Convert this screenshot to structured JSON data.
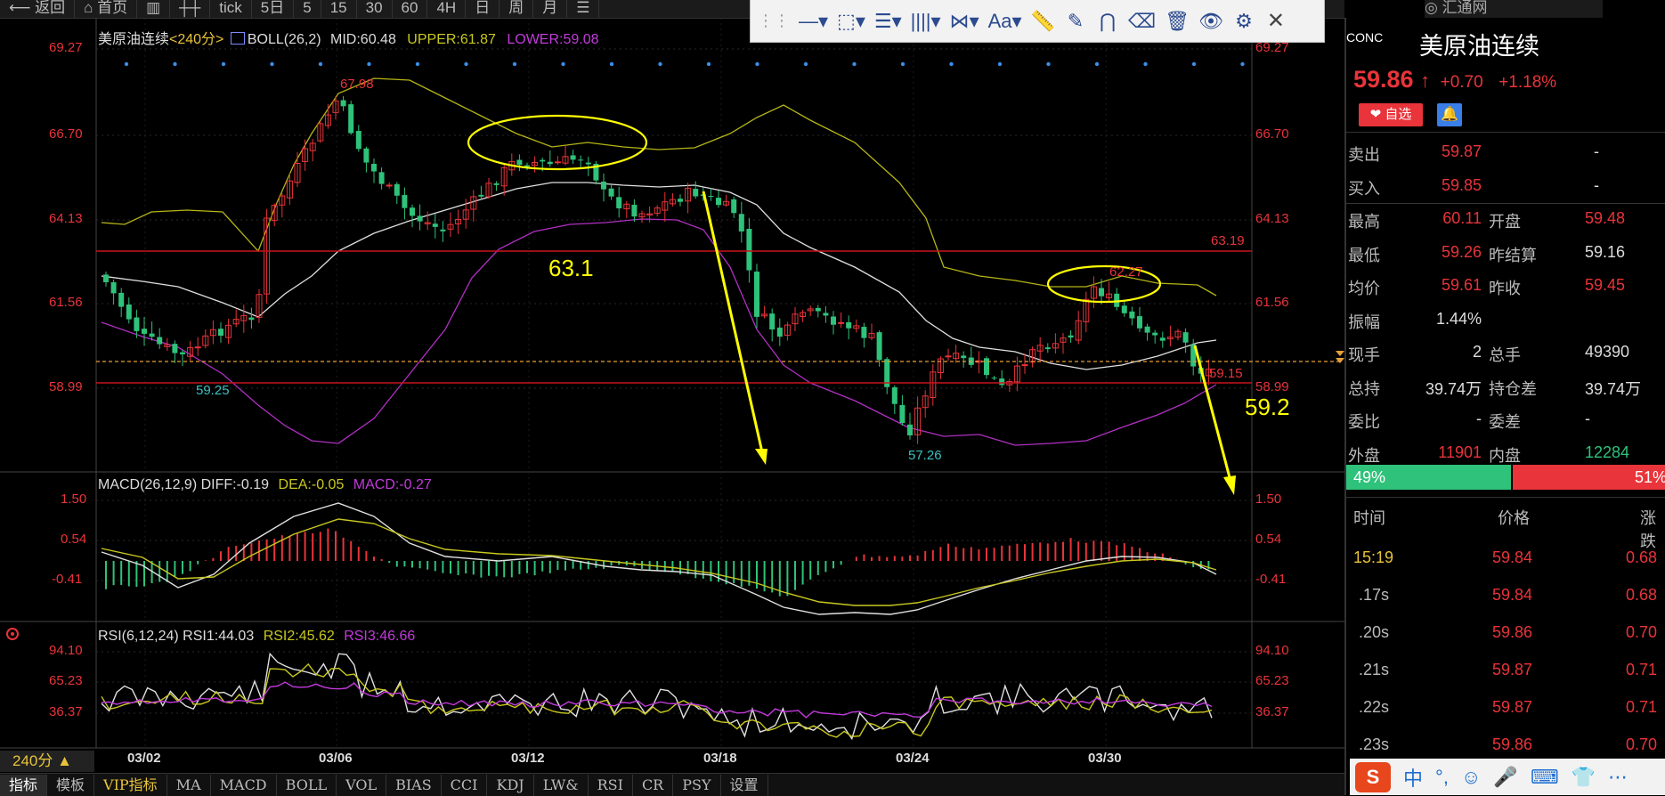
{
  "toolbar": {
    "items": [
      "返回",
      "首页",
      "",
      "",
      "tick",
      "5日",
      "5",
      "15",
      "30",
      "60",
      "4H",
      "日",
      "周",
      "月",
      ""
    ]
  },
  "drawing_toolbar": {
    "tools": [
      {
        "icon": "horizontal-line-icon",
        "glyph": "—▾"
      },
      {
        "icon": "rectangle-icon",
        "glyph": "⬚▾"
      },
      {
        "icon": "fibonacci-icon",
        "glyph": "☰▾"
      },
      {
        "icon": "parallel-lines-icon",
        "glyph": "||||▾"
      },
      {
        "icon": "pattern-icon",
        "glyph": "⋈▾"
      },
      {
        "icon": "text-tool-icon",
        "glyph": "Aa▾"
      },
      {
        "icon": "ruler-icon",
        "glyph": "📏"
      },
      {
        "icon": "pen-icon",
        "glyph": "✎"
      },
      {
        "icon": "magnet-icon",
        "glyph": "⋂"
      },
      {
        "icon": "eraser-icon",
        "glyph": "⌫"
      },
      {
        "icon": "trash-icon",
        "glyph": "🗑"
      },
      {
        "icon": "eye-icon",
        "glyph": "👁"
      },
      {
        "icon": "settings-icon",
        "glyph": "⚙"
      },
      {
        "icon": "close-icon",
        "glyph": "✕"
      }
    ]
  },
  "huitong": "汇通网",
  "main_chart": {
    "legend_title": "美原油连续",
    "legend_period": "<240分>",
    "legend_boll": "BOLL(26,2)",
    "legend_mid": "MID:60.48",
    "legend_upper": "UPPER:61.87",
    "legend_lower": "LOWER:59.08",
    "y_ticks": [
      "69.27",
      "66.70",
      "64.13",
      "61.56",
      "58.99"
    ],
    "x_ticks": [
      "03/02",
      "03/06",
      "03/12",
      "03/18",
      "03/24",
      "03/30"
    ],
    "price_labels": {
      "high": "67.98",
      "low1": "59.25",
      "low2": "57.26",
      "high2": "62.27",
      "level_63": "63.19",
      "level_59": "59.15"
    },
    "annotations": {
      "a1": "63.1",
      "a2": "59.2"
    }
  },
  "macd": {
    "legend": "MACD(26,12,9)",
    "diff": "DIFF:-0.19",
    "dea": "DEA:-0.05",
    "macd": "MACD:-0.27",
    "y_ticks": [
      "1.50",
      "0.54",
      "-0.41"
    ]
  },
  "rsi": {
    "legend": "RSI(6,12,24)",
    "rsi1": "RSI1:44.03",
    "rsi2": "RSI2:45.62",
    "rsi3": "RSI3:46.66",
    "y_ticks": [
      "94.10",
      "65.23",
      "36.37"
    ]
  },
  "timeframe": "240分 ▲",
  "bottom_tabs": [
    "指标",
    "模板",
    "VIP指标",
    "MA",
    "MACD",
    "BOLL",
    "VOL",
    "BIAS",
    "CCI",
    "KDJ",
    "LW&",
    "RSI",
    "CR",
    "PSY",
    "设置"
  ],
  "quote": {
    "code_partial": "CONC",
    "name": "美原油连续",
    "price": "59.86",
    "arrow": "↑",
    "change": "+0.70",
    "change_pct": "+1.18%",
    "watch_label": "自选",
    "rows": [
      {
        "l1": "卖出",
        "v1": "59.87",
        "l2": "",
        "v2": "-"
      },
      {
        "l1": "买入",
        "v1": "59.85",
        "l2": "",
        "v2": "-"
      },
      {
        "l1": "最高",
        "v1": "60.11",
        "l2": "开盘",
        "v2": "59.48"
      },
      {
        "l1": "最低",
        "v1": "59.26",
        "l2": "昨结算",
        "v2": "59.16"
      },
      {
        "l1": "均价",
        "v1": "59.61",
        "l2": "昨收",
        "v2": "59.45"
      },
      {
        "l1": "振幅",
        "v1": "1.44%",
        "l2": "",
        "v2": ""
      },
      {
        "l1": "现手",
        "v1": "2",
        "l2": "总手",
        "v2": "49390"
      },
      {
        "l1": "总持",
        "v1": "39.74万",
        "l2": "持仓差",
        "v2": "39.74万"
      },
      {
        "l1": "委比",
        "v1": "-",
        "l2": "委差",
        "v2": "-"
      },
      {
        "l1": "外盘",
        "v1": "11901",
        "l2": "内盘",
        "v2": "12284"
      }
    ],
    "buy_pct": "49%",
    "sell_pct": "51%",
    "ticks_header": {
      "time": "时间",
      "price": "价格",
      "change": "涨跌"
    },
    "ticks": [
      {
        "t": "15:19",
        "p": "59.84",
        "c": "0.68"
      },
      {
        "t": ".17s",
        "p": "59.84",
        "c": "0.68"
      },
      {
        "t": ".20s",
        "p": "59.86",
        "c": "0.70"
      },
      {
        "t": ".21s",
        "p": "59.87",
        "c": "0.71"
      },
      {
        "t": ".22s",
        "p": "59.87",
        "c": "0.71"
      },
      {
        "t": ".23s",
        "p": "59.86",
        "c": "0.70"
      }
    ]
  },
  "sogou": {
    "logo": "S",
    "items": [
      "中",
      "°,",
      "☺",
      "🎤",
      "⌨",
      "👕",
      "⋯"
    ]
  },
  "colors": {
    "up": "#e8343a",
    "down": "#2fc27a",
    "boll_mid": "#e0e0e0",
    "boll_upper": "#b5b516",
    "boll_lower": "#b02fc2",
    "annotation": "#ffff00"
  }
}
